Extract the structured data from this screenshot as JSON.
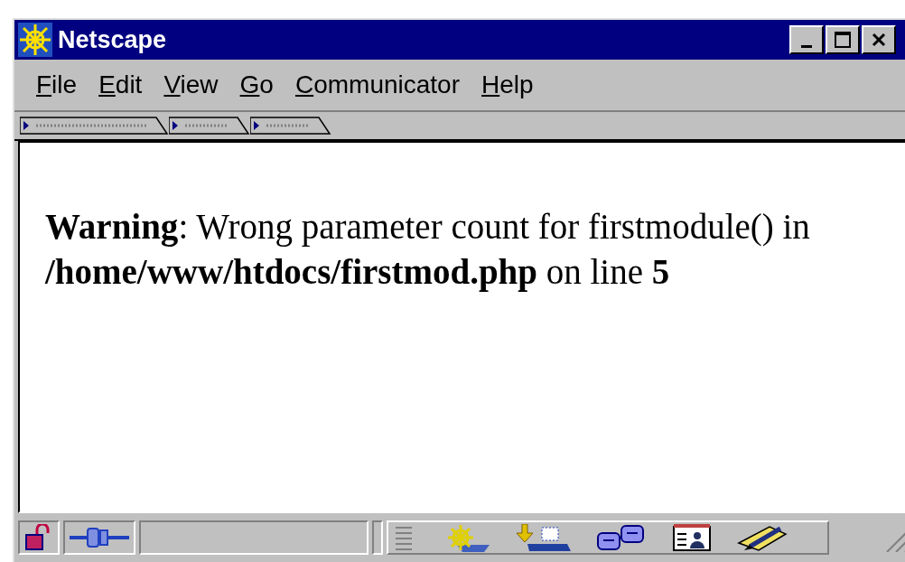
{
  "window": {
    "title": "Netscape"
  },
  "menu": [
    {
      "label": "File"
    },
    {
      "label": "Edit"
    },
    {
      "label": "View"
    },
    {
      "label": "Go"
    },
    {
      "label": "Communicator"
    },
    {
      "label": "Help"
    }
  ],
  "content": {
    "message": "**Warning**: Wrong parameter count for firstmodule() in **/home/www/htdocs/firstmod.php** on line **5**"
  }
}
